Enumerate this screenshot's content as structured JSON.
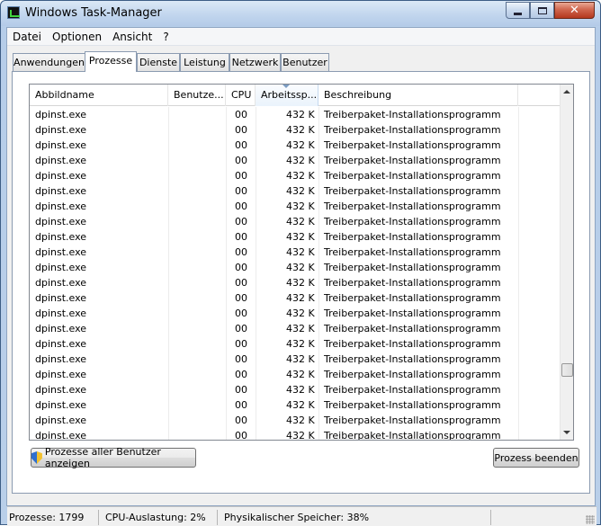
{
  "window": {
    "title": "Windows Task-Manager"
  },
  "menu": [
    "Datei",
    "Optionen",
    "Ansicht",
    "?"
  ],
  "tabs": [
    "Anwendungen",
    "Prozesse",
    "Dienste",
    "Leistung",
    "Netzwerk",
    "Benutzer"
  ],
  "active_tab": "Prozesse",
  "columns": [
    "Abbildname",
    "Benutze...",
    "CPU",
    "Arbeitssp...",
    "Beschreibung"
  ],
  "sorted_column": "Arbeitssp...",
  "row_template": {
    "image": "dpinst.exe",
    "user": "",
    "cpu": "00",
    "memory": "432 K",
    "description": "Treiberpaket-Installationsprogramm"
  },
  "visible_row_count": 23,
  "buttons": {
    "show_all": "Prozesse aller Benutzer anzeigen",
    "end_process": "Prozess beenden"
  },
  "status": {
    "processes": "Prozesse: 1799",
    "cpu": "CPU-Auslastung: 2%",
    "memory": "Physikalischer Speicher: 38%"
  },
  "colors": {
    "title_bar": "#c2d6ee",
    "close_button": "#c9513a",
    "sorted_header": "#eaf3fc"
  },
  "icons": [
    "task-manager-icon",
    "minimize-icon",
    "maximize-icon",
    "close-icon",
    "shield-icon",
    "scroll-up-arrow-icon",
    "scroll-down-arrow-icon",
    "resize-grip-icon"
  ]
}
